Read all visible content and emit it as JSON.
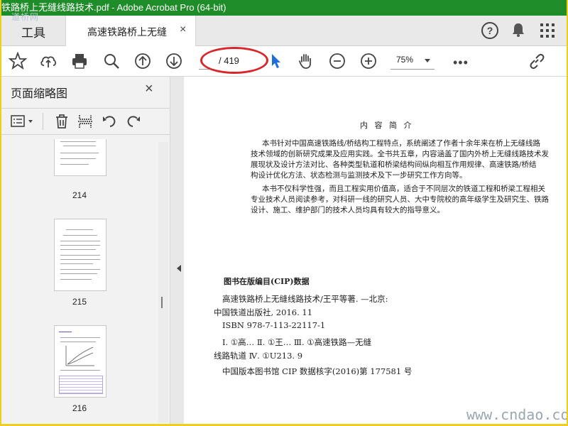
{
  "window": {
    "title": "铁路桥上无缝线路技术.pdf - Adobe Acrobat Pro (64-bit)"
  },
  "watermark_top": "道桥网",
  "tabs": {
    "tools": "工具",
    "document": "高速铁路桥上无缝",
    "close": "×"
  },
  "toolbar": {
    "page_current": "",
    "page_total": "/ 419",
    "zoom": "75%",
    "more": "•••"
  },
  "sidebar": {
    "title": "页面缩略图",
    "close": "×",
    "thumbnails": [
      {
        "label": "214"
      },
      {
        "label": "215"
      },
      {
        "label": "216"
      }
    ]
  },
  "document": {
    "summary_title": "内 容 简 介",
    "summary_lines": [
      "本书针对中国高速铁路线/桥结构工程特点，系统阐述了作者十余年来在桥上无缝线路",
      "技术领域的创新研究成果及应用实践。全书共五章，内容涵盖了国内外桥上无缝线路技术发",
      "展现状及设计方法对比、各种类型轨道和桥梁结构间纵向相互作用规律、高速铁路/桥结",
      "构设计优化方法、状态检测与监测技术及下一步研究工作方向等。",
      "本书不仅科学性强，而且工程实用价值高，适合于不同层次的铁道工程和桥梁工程相关",
      "专业技术人员阅读参考，对科研一线的研究人员、大中专院校的高年级学生及研究生、铁路",
      "设计、施工、维护部门的技术人员均具有较大的指导意义。"
    ],
    "cip_heading": "图书在版编目(CIP)数据",
    "cip_lines": [
      "高速铁路桥上无缝线路技术/王平等著. —北京:",
      "中国铁道出版社, 2016. 11",
      "ISBN 978-7-113-22117-1",
      "Ⅰ. ①高…  Ⅱ. ①王…  Ⅲ. ①高速铁路—无缝",
      "线路轨道  Ⅳ. ①U213. 9"
    ],
    "cip_number": "中国版本图书馆 CIP 数据核字(2016)第 177581 号"
  },
  "watermark_br": "www.cndao.com"
}
